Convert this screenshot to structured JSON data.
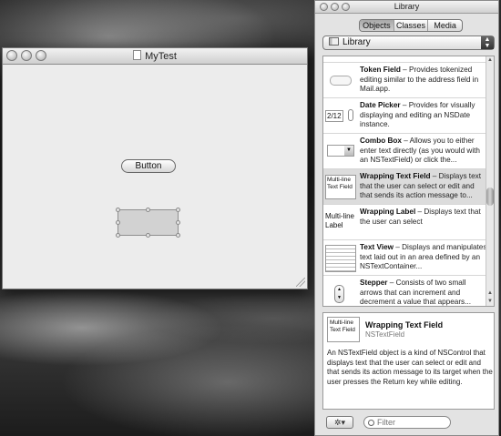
{
  "mytest_window": {
    "title": "MyTest",
    "button_label": "Button"
  },
  "library": {
    "title": "Library",
    "tabs": [
      {
        "label": "Objects",
        "active": true
      },
      {
        "label": "Classes",
        "active": false
      },
      {
        "label": "Media",
        "active": false
      }
    ],
    "popup_selected": "Library",
    "items": [
      {
        "name": "Token Field",
        "description": "Provides tokenized editing similar to the address field in Mail.app."
      },
      {
        "name": "Date Picker",
        "description": "Provides for visually displaying and editing an NSDate instance.",
        "thumb_text": "2/12"
      },
      {
        "name": "Combo Box",
        "description": "Allows you to either enter text directly (as you would with an NSTextField) or click the..."
      },
      {
        "name": "Wrapping Text Field",
        "description": "Displays text that the user can select or edit and that sends its action message to...",
        "thumb_text": "Multi-line Text Field",
        "selected": true
      },
      {
        "name": "Wrapping Label",
        "description": "Displays text that the user can select",
        "thumb_text": "Multi-line Label"
      },
      {
        "name": "Text View",
        "description": "Displays and manipulates text laid out in an area defined by an NSTextContainer..."
      },
      {
        "name": "Stepper",
        "description": "Consists of two small arrows that can increment and decrement a value that appears..."
      }
    ],
    "detail": {
      "name": "Wrapping Text Field",
      "class_name": "NSTextField",
      "thumb_text": "Multi-line Text Field",
      "description": "An NSTextField object is a kind of NSControl that displays text that the user can select or edit and that sends its action message to its target when the user presses the Return key while editing."
    },
    "filter_placeholder": "Filter"
  }
}
